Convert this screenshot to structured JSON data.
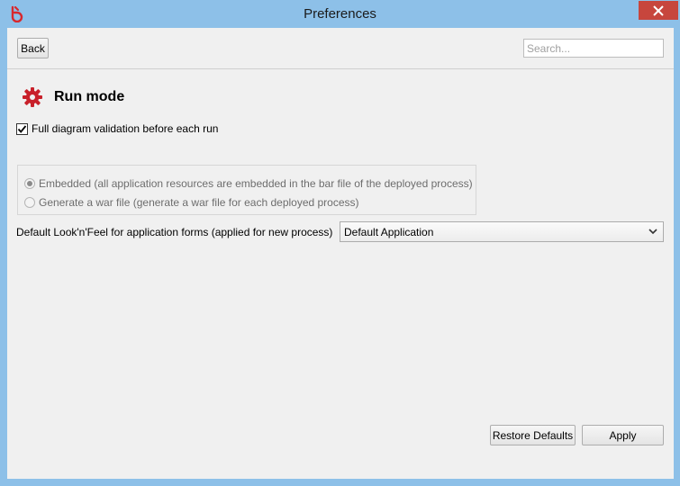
{
  "window": {
    "title": "Preferences",
    "accent_color": "#8dc0e8",
    "close_color": "#c7463d"
  },
  "toolbar": {
    "back_label": "Back",
    "search_placeholder": "Search...",
    "search_value": ""
  },
  "page": {
    "title": "Run mode",
    "title_icon": "gear-icon",
    "validation_checkbox": {
      "label": "Full diagram validation before each run",
      "checked": true
    },
    "deployment_options": [
      {
        "label": "Embedded (all application resources are embedded in the bar file of the deployed process)",
        "selected": true,
        "enabled": false
      },
      {
        "label": "Generate a war file (generate a war file for each deployed process)",
        "selected": false,
        "enabled": false
      }
    ],
    "look_and_feel": {
      "label": "Default Look'n'Feel for application forms (applied for new process)",
      "selected_value": "Default Application"
    }
  },
  "footer": {
    "restore_label": "Restore Defaults",
    "apply_label": "Apply"
  }
}
